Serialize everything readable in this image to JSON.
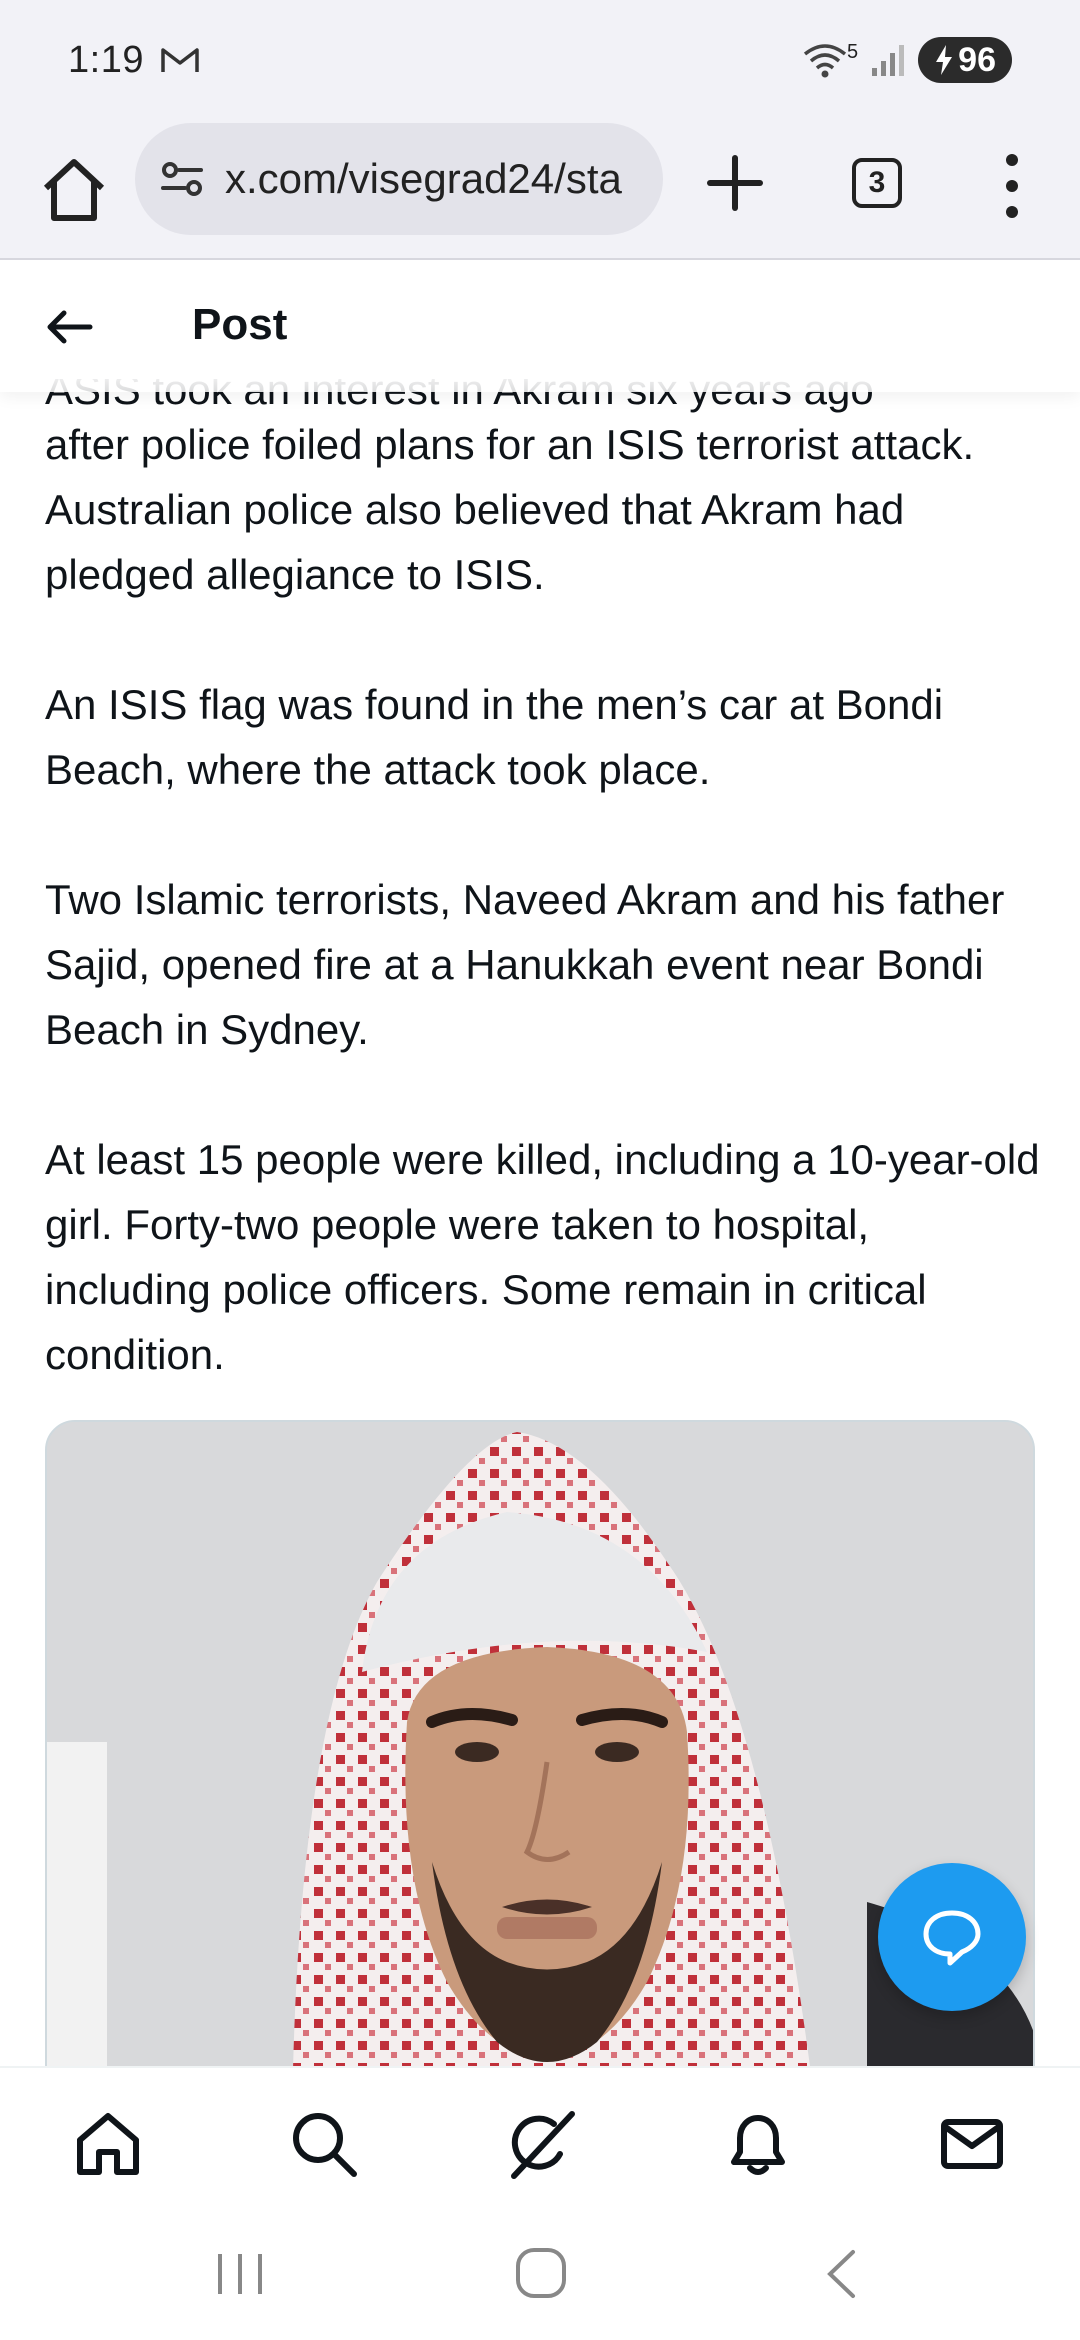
{
  "status_bar": {
    "time": "1:19",
    "battery": "96",
    "network_label": "5"
  },
  "browser": {
    "url": "x.com/visegrad24/sta",
    "tab_count": "3"
  },
  "post_header": {
    "title": "Post"
  },
  "article": {
    "clipped_line": "ASIS took an interest in Akram six years ago",
    "paragraphs": [
      "after police foiled plans for an ISIS terrorist attack. Australian police also believed that Akram had pledged allegiance to ISIS.",
      "An ISIS flag was found in the men’s car at Bondi Beach, where the attack took place.",
      "Two Islamic terrorists, Naveed Akram and his father Sajid, opened fire at a Hanukkah event near Bondi Beach in Sydney.",
      "At least 15 people were killed, including a 10-year-old girl. Forty-two people were taken to hospital, including police officers. Some remain in critical condition."
    ]
  },
  "media": {
    "icon": "photo-of-man"
  },
  "colors": {
    "accent": "#1d9bf0",
    "text": "#0f1419",
    "chrome_bg": "#f2f2f7"
  },
  "bottom_nav": {
    "items": [
      "home-icon",
      "search-icon",
      "grok-icon",
      "bell-icon",
      "mail-icon"
    ]
  },
  "system_nav": {
    "items": [
      "recents-icon",
      "home-circle-icon",
      "back-chevron-icon"
    ]
  }
}
